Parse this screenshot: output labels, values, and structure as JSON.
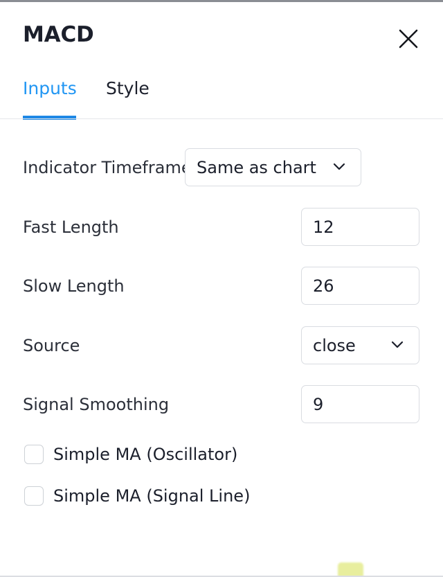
{
  "dialog": {
    "title": "MACD",
    "close_icon": "close-icon"
  },
  "tabs": [
    {
      "label": "Inputs",
      "active": true
    },
    {
      "label": "Style",
      "active": false
    }
  ],
  "colors": {
    "accent": "#1e88e5",
    "tab_active_text": "#2196f3",
    "text": "#1b1f2b",
    "border": "#d9dce1",
    "marker": "#e8ee9e"
  },
  "form": {
    "indicator_timeframe": {
      "label": "Indicator Timeframe",
      "value": "Same as chart",
      "control": "select",
      "icon": "chevron-down-icon"
    },
    "fast_length": {
      "label": "Fast Length",
      "value": "12",
      "control": "number-input"
    },
    "slow_length": {
      "label": "Slow Length",
      "value": "26",
      "control": "number-input"
    },
    "source": {
      "label": "Source",
      "value": "close",
      "control": "select",
      "icon": "chevron-down-icon"
    },
    "signal_smoothing": {
      "label": "Signal Smoothing",
      "value": "9",
      "control": "number-input"
    },
    "checkboxes": [
      {
        "label": "Simple MA (Oscillator)",
        "checked": false
      },
      {
        "label": "Simple MA (Signal Line)",
        "checked": false
      }
    ]
  }
}
